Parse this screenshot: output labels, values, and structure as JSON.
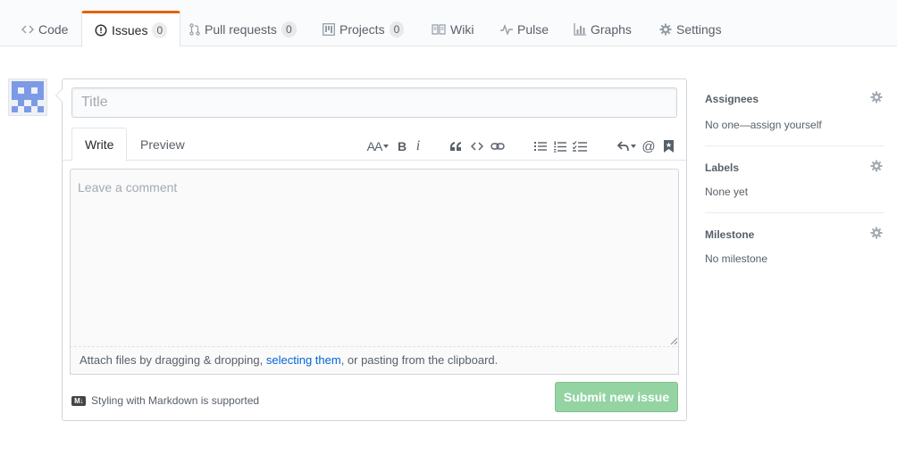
{
  "nav": {
    "tabs": [
      {
        "label": "Code",
        "icon": "code-icon"
      },
      {
        "label": "Issues",
        "icon": "issue-opened-icon",
        "count": "0"
      },
      {
        "label": "Pull requests",
        "icon": "git-pull-request-icon",
        "count": "0"
      },
      {
        "label": "Projects",
        "icon": "project-icon",
        "count": "0"
      },
      {
        "label": "Wiki",
        "icon": "book-icon"
      },
      {
        "label": "Pulse",
        "icon": "pulse-icon"
      },
      {
        "label": "Graphs",
        "icon": "graph-icon"
      },
      {
        "label": "Settings",
        "icon": "gear-icon"
      }
    ],
    "selected": "Issues"
  },
  "form": {
    "title_placeholder": "Title",
    "tabs": {
      "write": "Write",
      "preview": "Preview"
    },
    "comment_placeholder": "Leave a comment",
    "attach": {
      "before": "Attach files by dragging & dropping, ",
      "link": "selecting them",
      "after": ", or pasting from the clipboard."
    },
    "markdown_note": "Styling with Markdown is supported",
    "submit_label": "Submit new issue"
  },
  "toolbar": {
    "header_label": "AA",
    "bold_label": "B",
    "italic_label": "i",
    "mention_label": "@"
  },
  "sidebar": {
    "assignees": {
      "title": "Assignees",
      "value": "No one—assign yourself"
    },
    "labels": {
      "title": "Labels",
      "value": "None yet"
    },
    "milestone": {
      "title": "Milestone",
      "value": "No milestone"
    }
  },
  "colors": {
    "accent_tab": "#e36209",
    "submit_disabled": "#94d3a2",
    "link": "#0366d6",
    "avatar": "#7d9ae6"
  }
}
